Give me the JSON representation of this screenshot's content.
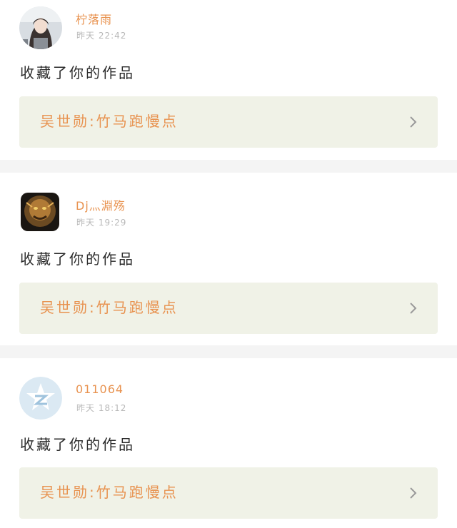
{
  "feed": [
    {
      "username": "柠落雨",
      "time": "昨天 22:42",
      "action": "收藏了你的作品",
      "work_title": "吴世勋:竹马跑慢点",
      "avatar_icon": "girl-photo-avatar"
    },
    {
      "username": "Dj灬淵殇",
      "time": "昨天 19:29",
      "action": "收藏了你的作品",
      "work_title": "吴世勋:竹马跑慢点",
      "avatar_icon": "monster-game-avatar"
    },
    {
      "username": "011064",
      "time": "昨天 18:12",
      "action": "收藏了你的作品",
      "work_title": "吴世勋:竹马跑慢点",
      "avatar_icon": "default-q-avatar"
    }
  ],
  "colors": {
    "accent": "#e8924f",
    "work_bg": "#f0f2e7",
    "time": "#b8b8b8",
    "divider": "#f4f4f4"
  }
}
